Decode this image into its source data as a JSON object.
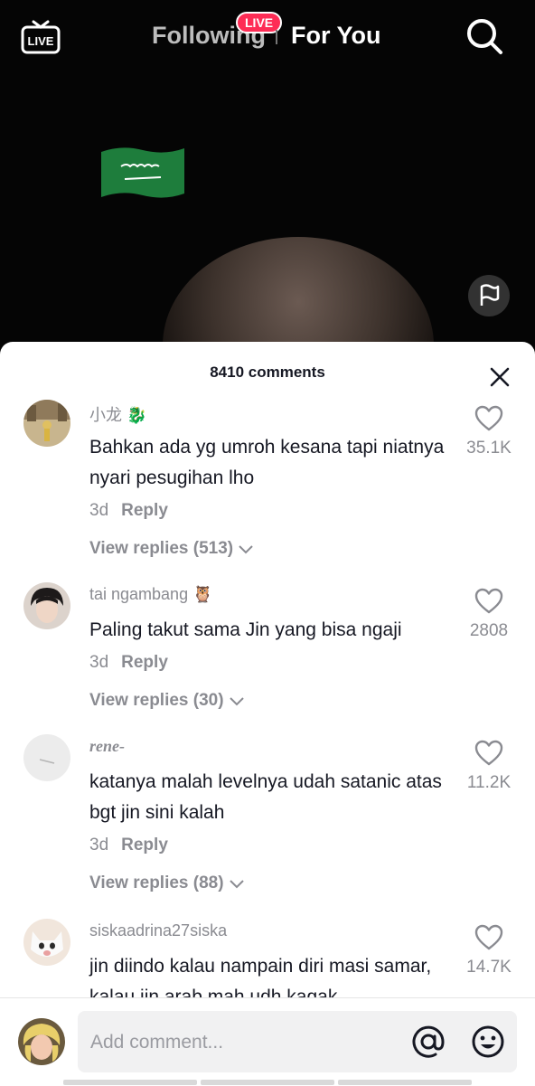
{
  "topbar": {
    "live_icon_label": "LIVE",
    "tab_following": "Following",
    "live_badge": "LIVE",
    "tab_for_you": "For You"
  },
  "comments_sheet": {
    "title": "8410 comments",
    "reply_label": "Reply",
    "comments": [
      {
        "username": "小龙 🐉",
        "text": "Bahkan ada yg umroh kesana tapi niatnya nyari pesugihan lho",
        "time": "3d",
        "view_replies": "View replies (513)",
        "likes": "35.1K"
      },
      {
        "username": "tai ngambang 🦉",
        "text": "Paling takut sama Jin yang bisa ngaji",
        "time": "3d",
        "view_replies": "View replies (30)",
        "likes": "2808"
      },
      {
        "username": "rene-",
        "text": "katanya malah levelnya udah satanic atas bgt jin sini kalah",
        "time": "3d",
        "view_replies": "View replies (88)",
        "likes": "11.2K"
      },
      {
        "username": "siskaadrina27siska",
        "text": "jin diindo kalau nampain diri masi samar, kalau jin arab mah udh kagak",
        "likes": "14.7K"
      }
    ]
  },
  "composer": {
    "placeholder": "Add comment..."
  },
  "colors": {
    "accent_live": "#fe2c55",
    "text_primary": "#161823",
    "text_secondary": "#8a8b91",
    "flag_green": "#1e7d3c"
  },
  "icons": [
    "live-tv-icon",
    "search-icon",
    "flag-report-icon",
    "close-icon",
    "heart-icon",
    "chevron-down-icon",
    "at-mention-icon",
    "emoji-icon"
  ]
}
